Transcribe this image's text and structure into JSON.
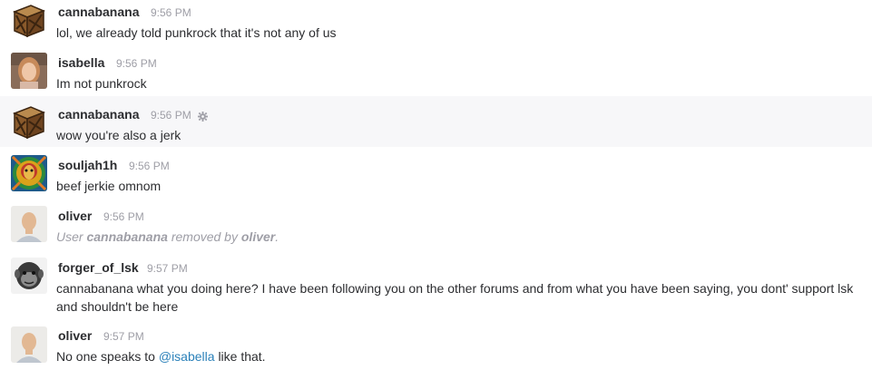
{
  "messages": [
    {
      "user": "cannabanana",
      "time": "9:56 PM",
      "text": "lol, we already told punkrock that it's not any of us",
      "avatar": "crate-icon"
    },
    {
      "user": "isabella",
      "time": "9:56 PM",
      "text": "Im not punkrock",
      "avatar": "user-photo"
    },
    {
      "user": "cannabanana",
      "time": "9:56 PM",
      "text": "wow you're also a jerk",
      "avatar": "crate-icon",
      "highlighted": true,
      "action_icon": "gear-icon"
    },
    {
      "user": "souljah1h",
      "time": "9:56 PM",
      "text": "beef jerkie omnom",
      "avatar": "psychedelic-art"
    },
    {
      "user": "oliver",
      "time": "9:56 PM",
      "system": {
        "prefix": "User",
        "target": "cannabanana",
        "middle": "removed by",
        "actor": "oliver"
      },
      "avatar": "user-photo"
    },
    {
      "user": "forger_of_lsk",
      "time": "9:57 PM",
      "text_line1": "cannabanana what you doing here? I have been following you on the other forums and from what you have been saying, you dont' support lsk",
      "text_line2": "and shouldn't be here",
      "avatar": "chimp-photo"
    },
    {
      "user": "oliver",
      "time": "9:57 PM",
      "text_before": "No one speaks to",
      "mention": "@isabella",
      "text_after": "like that.",
      "avatar": "user-photo"
    }
  ],
  "colors": {
    "name": "#2c2d30",
    "timestamp": "#9e9ea6",
    "mention": "#2a80b9",
    "highlight_bg": "#f7f7f9"
  }
}
